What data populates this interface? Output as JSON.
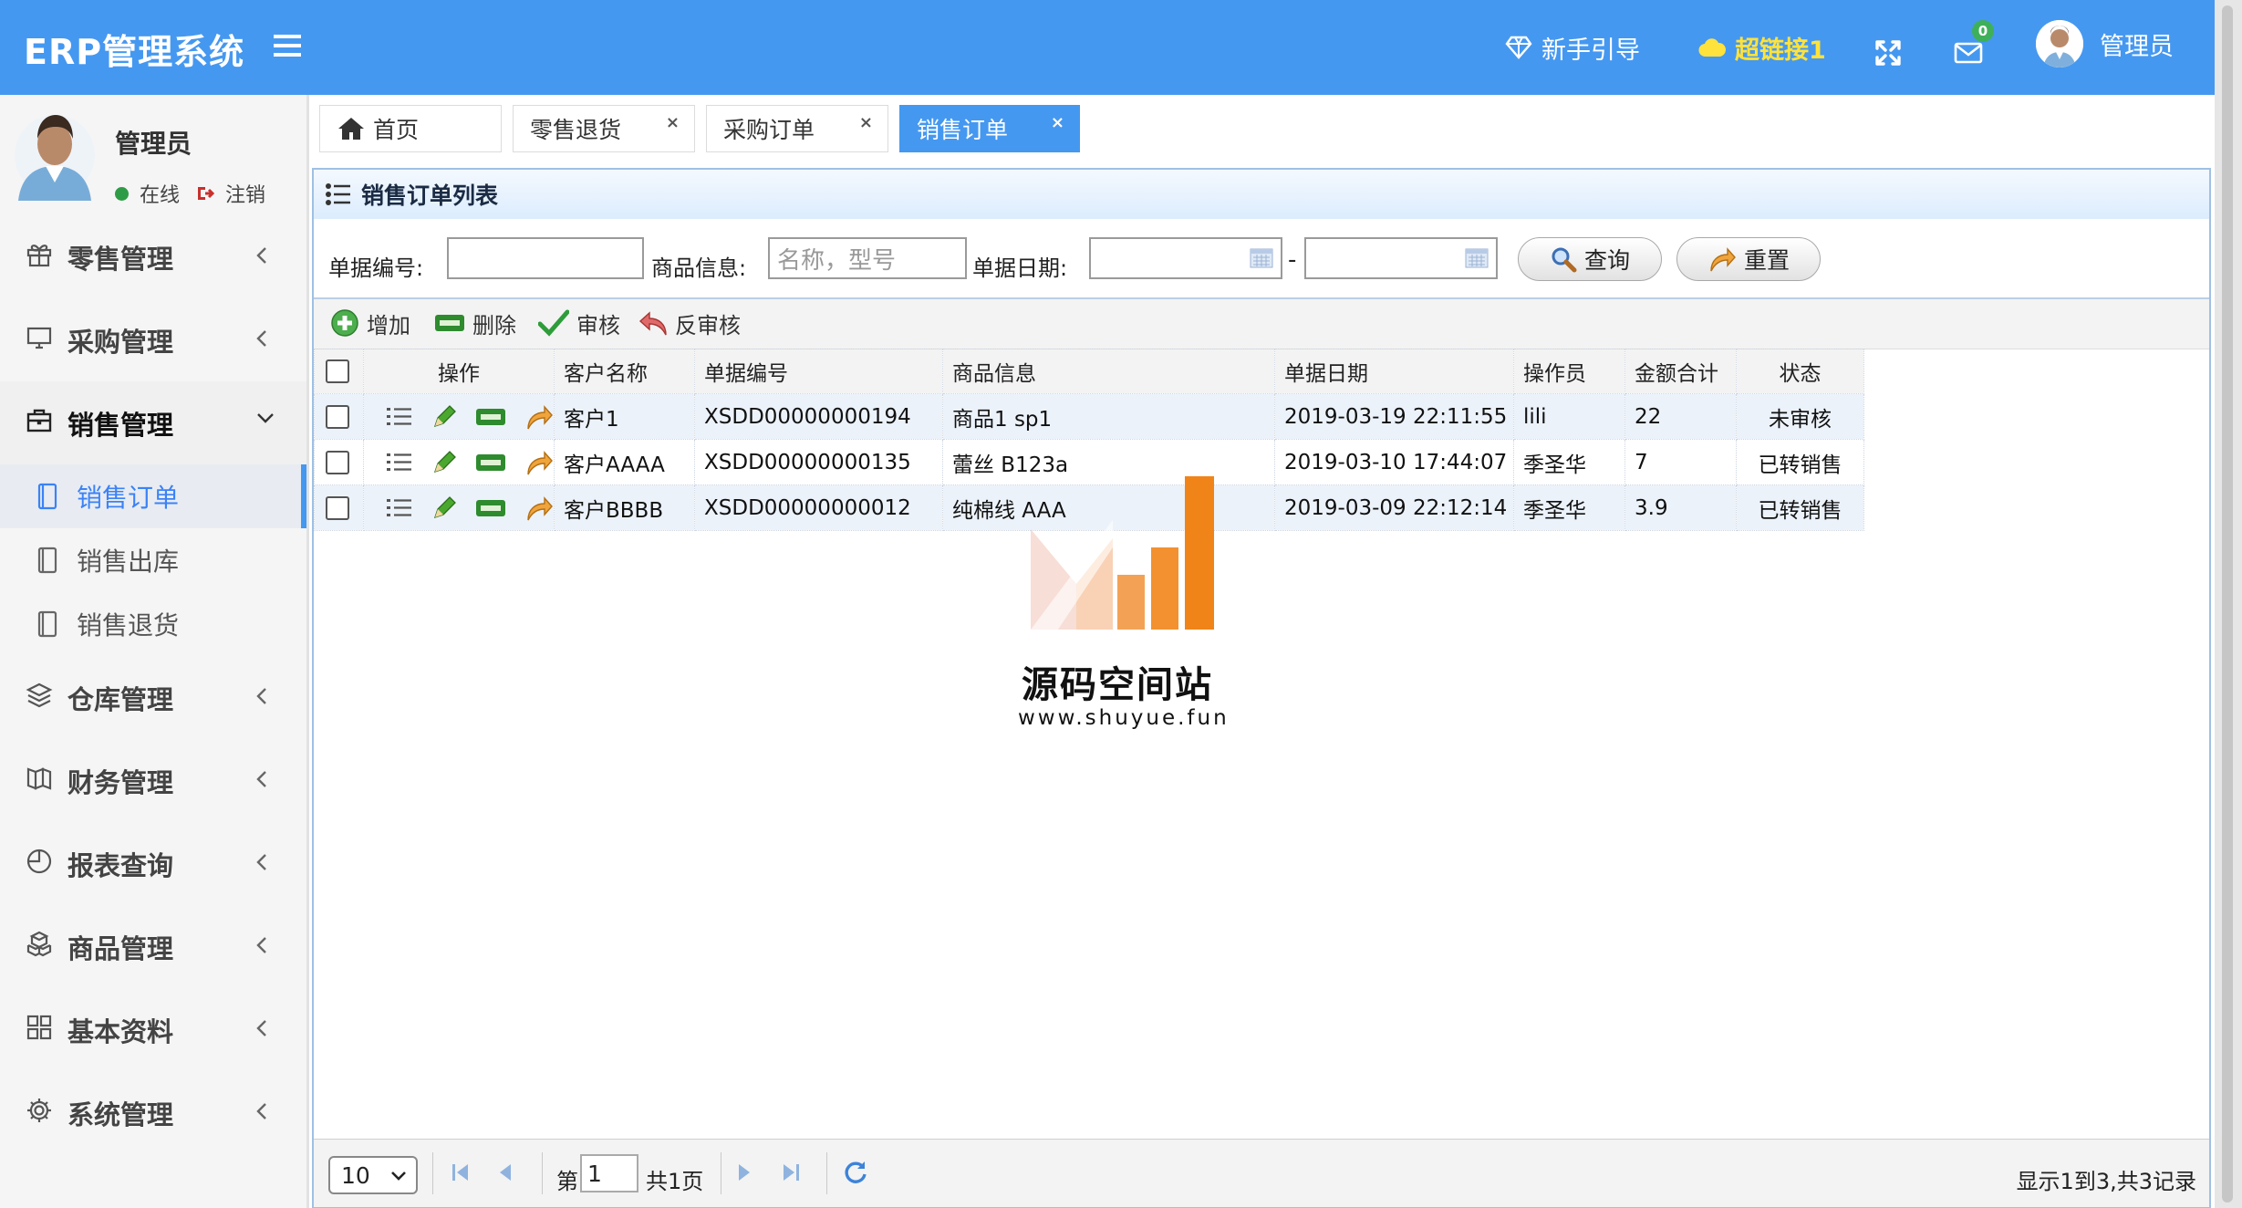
{
  "header": {
    "app_title": "ERP管理系统",
    "guide_label": "新手引导",
    "link_label": "超链接1",
    "mail_badge": "0",
    "user_label": "管理员",
    "color_primary": "#4598f0",
    "color_link": "#ffe23b"
  },
  "sidebar": {
    "user": {
      "name": "管理员",
      "status": "在线",
      "logout": "注销"
    },
    "items": [
      {
        "label": "零售管理",
        "icon": "gift-icon",
        "expanded": false
      },
      {
        "label": "采购管理",
        "icon": "monitor-icon",
        "expanded": false
      },
      {
        "label": "销售管理",
        "icon": "briefcase-icon",
        "expanded": true,
        "children": [
          {
            "label": "销售订单",
            "active": true
          },
          {
            "label": "销售出库",
            "active": false
          },
          {
            "label": "销售退货",
            "active": false
          }
        ]
      },
      {
        "label": "仓库管理",
        "icon": "layers-icon",
        "expanded": false
      },
      {
        "label": "财务管理",
        "icon": "book-icon",
        "expanded": false
      },
      {
        "label": "报表查询",
        "icon": "pie-chart-icon",
        "expanded": false
      },
      {
        "label": "商品管理",
        "icon": "cubes-icon",
        "expanded": false
      },
      {
        "label": "基本资料",
        "icon": "grid-icon",
        "expanded": false
      },
      {
        "label": "系统管理",
        "icon": "gear-icon",
        "expanded": false
      }
    ]
  },
  "tabs": [
    {
      "label": "首页",
      "closable": false,
      "active": false
    },
    {
      "label": "零售退货",
      "closable": true,
      "active": false
    },
    {
      "label": "采购订单",
      "closable": true,
      "active": false
    },
    {
      "label": "销售订单",
      "closable": true,
      "active": true
    }
  ],
  "tab_close_glyph": "×",
  "panel": {
    "title": "销售订单列表"
  },
  "search": {
    "doc_no_label": "单据编号:",
    "doc_no_value": "",
    "product_label": "商品信息:",
    "product_placeholder": "名称，型号",
    "date_label": "单据日期:",
    "date_from": "",
    "date_to": "",
    "date_separator": "-",
    "query_button": "查询",
    "reset_button": "重置"
  },
  "toolbar": {
    "add": "增加",
    "delete": "删除",
    "audit": "审核",
    "unaudit": "反审核"
  },
  "table": {
    "columns": [
      "操作",
      "客户名称",
      "单据编号",
      "商品信息",
      "单据日期",
      "操作员",
      "金额合计",
      "状态"
    ],
    "rows": [
      {
        "customer": "客户1",
        "doc_no": "XSDD00000000194",
        "product": "商品1 sp1",
        "date": "2019-03-19 22:11:55",
        "operator": "lili",
        "amount": "22",
        "status": "未审核",
        "status_type": "unaudited"
      },
      {
        "customer": "客户AAAA",
        "doc_no": "XSDD00000000135",
        "product": "蕾丝 B123a",
        "date": "2019-03-10 17:44:07",
        "operator": "季圣华",
        "amount": "7",
        "status": "已转销售",
        "status_type": "converted"
      },
      {
        "customer": "客户BBBB",
        "doc_no": "XSDD00000000012",
        "product": "纯棉线 AAA",
        "date": "2019-03-09 22:12:14",
        "operator": "季圣华",
        "amount": "3.9",
        "status": "已转销售",
        "status_type": "converted"
      }
    ]
  },
  "pager": {
    "page_size": "10",
    "page_prefix": "第",
    "page_value": "1",
    "page_total": "共1页",
    "info": "显示1到3,共3记录"
  },
  "watermark": {
    "title": "源码空间站",
    "url": "www.shuyue.fun"
  }
}
